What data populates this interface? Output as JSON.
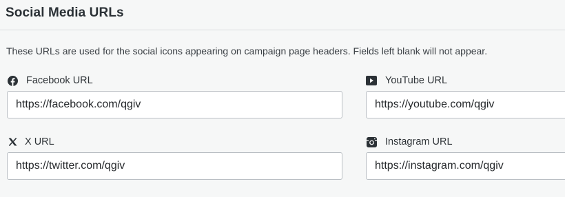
{
  "section": {
    "title": "Social Media URLs",
    "description": "These URLs are used for the social icons appearing on campaign page headers. Fields left blank will not appear."
  },
  "fields": {
    "facebook": {
      "label": "Facebook URL",
      "value": "https://facebook.com/qgiv",
      "icon": "facebook-icon"
    },
    "youtube": {
      "label": "YouTube URL",
      "value": "https://youtube.com/qgiv",
      "icon": "youtube-icon"
    },
    "x": {
      "label": "X URL",
      "value": "https://twitter.com/qgiv",
      "icon": "x-icon"
    },
    "instagram": {
      "label": "Instagram URL",
      "value": "https://instagram.com/qgiv",
      "icon": "instagram-icon"
    }
  }
}
